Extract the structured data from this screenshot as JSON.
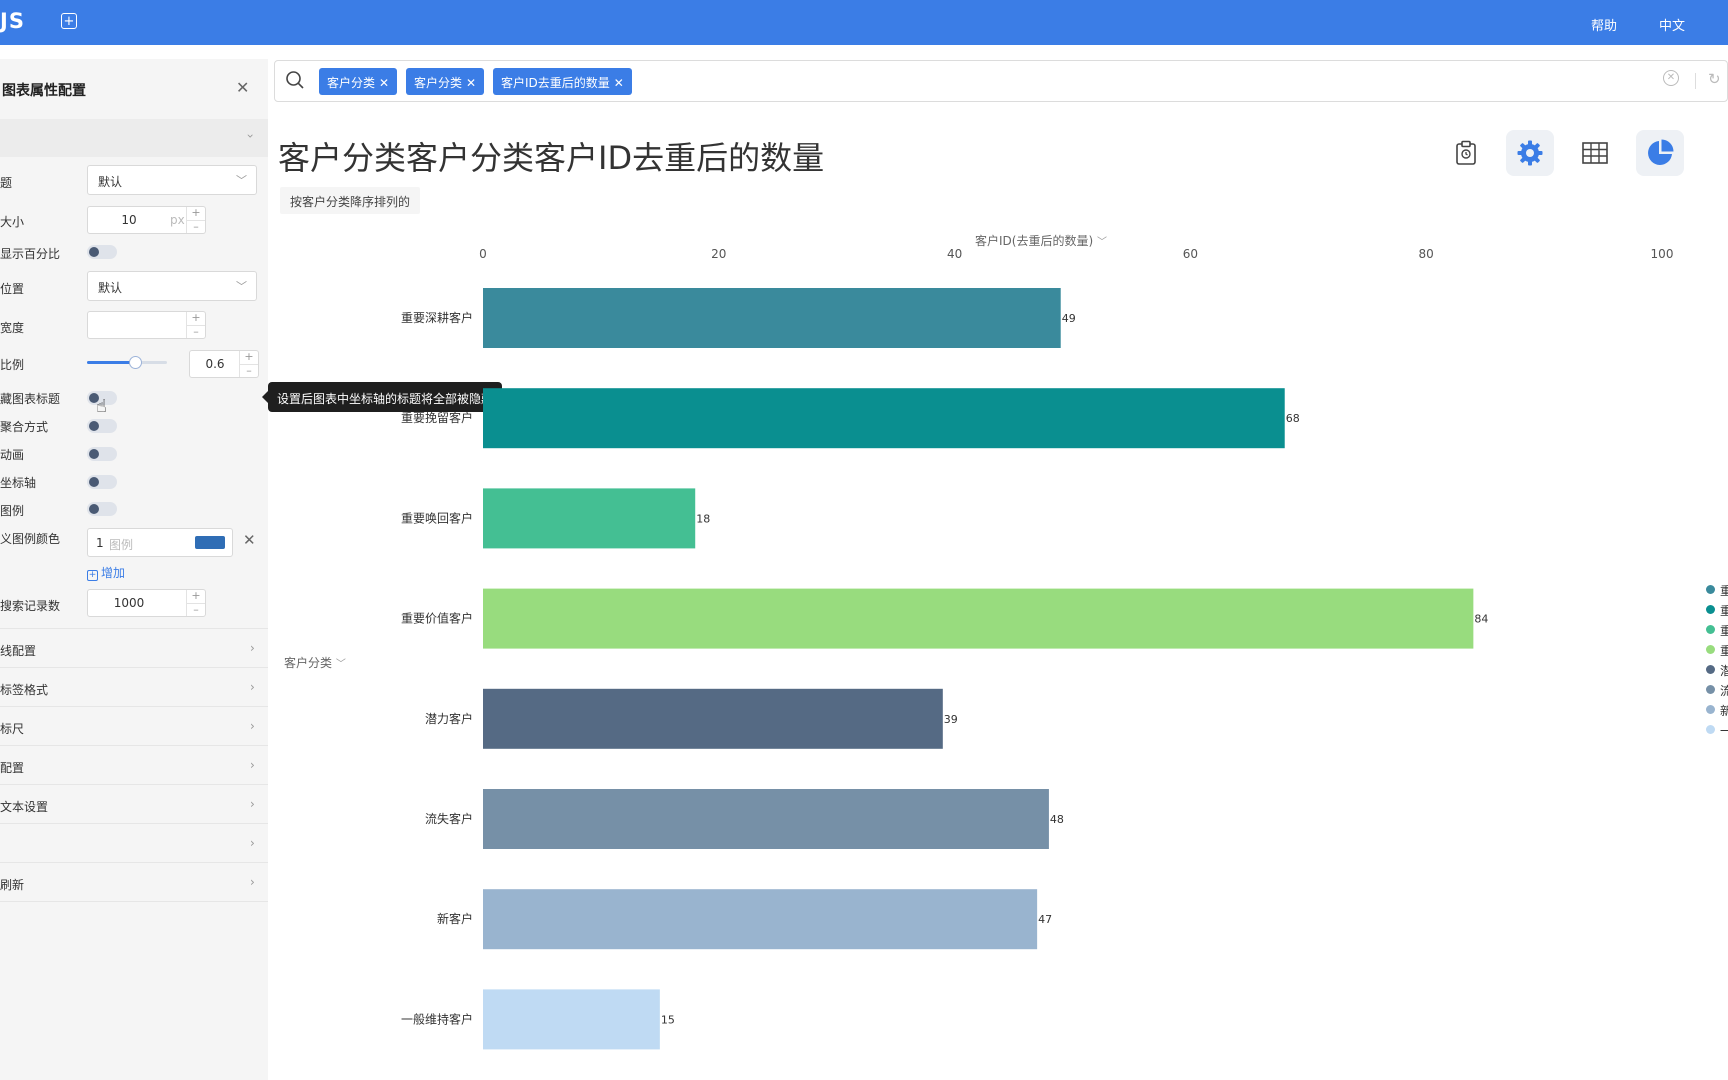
{
  "topbar": {
    "brand": "JS",
    "help": "帮助",
    "lang": "中文"
  },
  "panel": {
    "title": "图表属性配置",
    "rows": {
      "r1_label": "题",
      "r1_value": "默认",
      "font_size_label": "大小",
      "font_size_value": "10",
      "font_size_unit": "px",
      "show_percent_label": "显示百分比",
      "position_label": "位置",
      "position_value": "默认",
      "width_label": "宽度",
      "width_value": "",
      "ratio_label": "比例",
      "ratio_value": "0.6",
      "ratio_level": 0.6,
      "hide_title_label": "藏图表标题",
      "agg_label": "聚合方式",
      "anim_label": "动画",
      "axis_label": "坐标轴",
      "legend_label": "图例",
      "custom_color_label": "义图例颜色",
      "color_index": "1",
      "color_placeholder": "图例",
      "color_swatch": "#2f6db5",
      "add_label": "增加",
      "max_records_label": "搜索记录数",
      "max_records_value": "1000"
    },
    "sections": [
      "线配置",
      "标签格式",
      "标尺",
      "配置",
      "文本设置",
      "",
      "刷新"
    ]
  },
  "tooltip": "设置后图表中坐标轴的标题将全部被隐藏",
  "search": {
    "tags": [
      "客户分类",
      "客户分类",
      "客户ID去重后的数量"
    ]
  },
  "chart": {
    "title": "客户分类客户分类客户ID去重后的数量",
    "sort_label": "按客户分类降序排列的",
    "xaxis_title": "客户ID(去重后的数量)",
    "yaxis_title": "客户分类"
  },
  "chart_data": {
    "type": "bar",
    "orientation": "horizontal",
    "title": "客户分类客户分类客户ID去重后的数量",
    "xlabel": "客户ID(去重后的数量)",
    "ylabel": "客户分类",
    "xlim": [
      0,
      100
    ],
    "xticks": [
      0,
      20,
      40,
      60,
      80,
      100
    ],
    "grid": false,
    "legend_position": "right",
    "categories": [
      "重要深耕客户",
      "重要挽留客户",
      "重要唤回客户",
      "重要价值客户",
      "潜力客户",
      "流失客户",
      "新客户",
      "一般维持客户"
    ],
    "values": [
      49,
      68,
      18,
      84,
      39,
      48,
      47,
      15
    ],
    "colors": [
      "#3a8a9c",
      "#0a8f90",
      "#44bf93",
      "#98dc7e",
      "#556a84",
      "#7690a7",
      "#99b4cf",
      "#bfdaf3"
    ],
    "legend": [
      "重",
      "重",
      "重",
      "重",
      "潜",
      "流",
      "新",
      "一"
    ]
  },
  "colors": {
    "accent": "#3b7de6"
  }
}
